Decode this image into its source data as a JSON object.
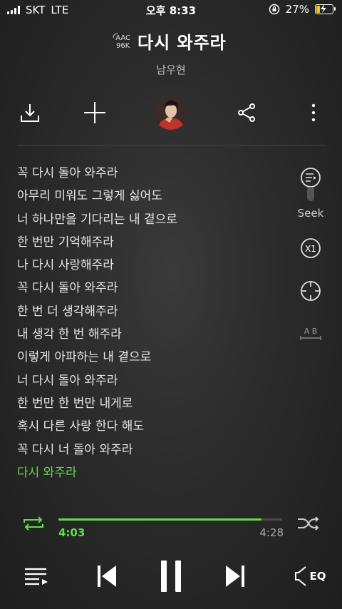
{
  "status": {
    "carrier": "SKT",
    "network": "LTE",
    "time": "오후 8:33",
    "battery_text": "27%",
    "battery_level": 0.27,
    "icons": [
      "signal-bars-icon",
      "orientation-lock-icon",
      "battery-charging-icon"
    ]
  },
  "player": {
    "quality_top": "AAC",
    "quality_bottom": "96K",
    "title": "다시 와주라",
    "artist": "남우현"
  },
  "actions": {
    "icons": [
      "download-icon",
      "add-icon",
      "album-art",
      "share-icon",
      "more-icon"
    ]
  },
  "lyrics": [
    "꼭 다시 돌아 와주라",
    "아무리 미워도 그렇게 싫어도",
    "너 하나만을 기다리는 내 곁으로",
    "한 번만 기억해주라",
    "나 다시 사랑해주라",
    "꼭 다시 돌아 와주라",
    "한 번 더 생각해주라",
    "내 생각 한 번 해주라",
    "이렇게 아파하는 내 곁으로",
    "너 다시 돌아 와주라",
    "한 번만 한 번만 내게로",
    "혹시 다른 사랑 한다 해도",
    "꼭 다시 너 돌아 와주라",
    "다시 와주라"
  ],
  "current_lyric_index": 13,
  "side": {
    "seek_label": "Seek",
    "speed_label": "X1",
    "ab_label": "A B"
  },
  "progress": {
    "current": "4:03",
    "total": "4:28",
    "fraction": 0.907
  },
  "colors": {
    "accent": "#5fdc46",
    "background": "#2b2b2b",
    "text": "#ffffff"
  },
  "controls": {
    "eq_label": "EQ",
    "icons": [
      "playlist-icon",
      "previous-icon",
      "pause-icon",
      "next-icon",
      "eq-icon",
      "repeat-icon",
      "shuffle-icon"
    ]
  }
}
